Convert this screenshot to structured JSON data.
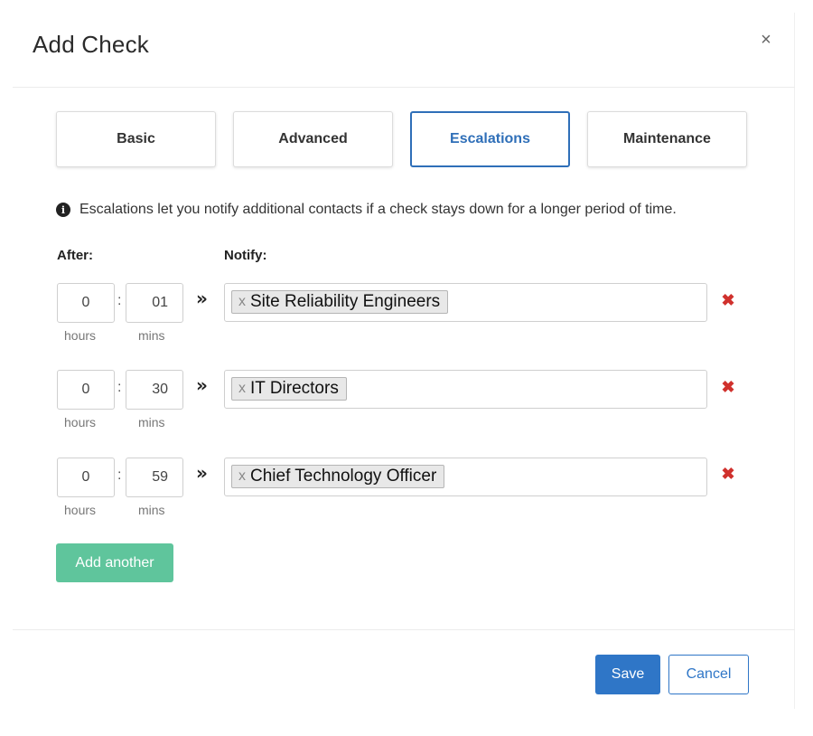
{
  "dialog": {
    "title": "Add Check",
    "close_glyph": "×"
  },
  "tabs": [
    {
      "label": "Basic",
      "active": false
    },
    {
      "label": "Advanced",
      "active": false
    },
    {
      "label": "Escalations",
      "active": true
    },
    {
      "label": "Maintenance",
      "active": false
    }
  ],
  "info": {
    "icon": "info-icon",
    "glyph": "i",
    "text": "Escalations let you notify additional contacts if a check stays down for a longer period of time."
  },
  "columns": {
    "after": "After:",
    "notify": "Notify:"
  },
  "units": {
    "hours": "hours",
    "mins": "mins"
  },
  "separator": ":",
  "arrow_glyph": "»",
  "tag_remove_glyph": "x",
  "row_remove_glyph": "✖",
  "escalations": [
    {
      "hours": "0",
      "mins": "01",
      "contact": "Site Reliability Engineers"
    },
    {
      "hours": "0",
      "mins": "30",
      "contact": "IT Directors"
    },
    {
      "hours": "0",
      "mins": "59",
      "contact": "Chief Technology Officer"
    }
  ],
  "buttons": {
    "add_another": "Add another",
    "save": "Save",
    "cancel": "Cancel"
  },
  "colors": {
    "accent_blue": "#2f76c7",
    "active_tab": "#2f6fb8",
    "add_green": "#5fc59c",
    "remove_red": "#d0312d"
  }
}
